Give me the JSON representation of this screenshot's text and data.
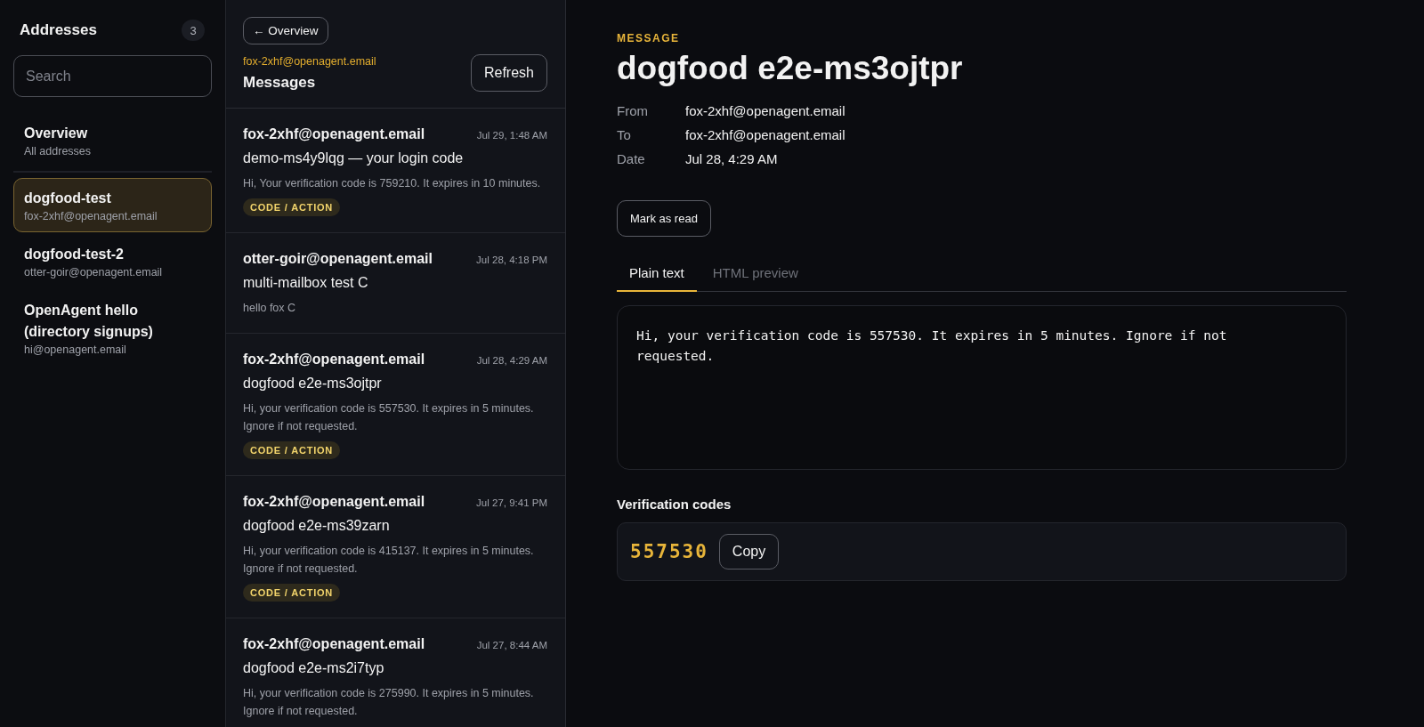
{
  "sidebar": {
    "title": "Addresses",
    "count": "3",
    "search": {
      "placeholder": "Search"
    },
    "overview": {
      "label": "Overview",
      "sublabel": "All addresses",
      "selected": false
    },
    "items": [
      {
        "name": "dogfood-test",
        "address": "fox-2xhf@openagent.email",
        "selected": true
      },
      {
        "name": "dogfood-test-2",
        "address": "otter-goir@openagent.email",
        "selected": false
      },
      {
        "name": "OpenAgent hello (directory signups)",
        "address": "hi@openagent.email",
        "selected": false
      }
    ]
  },
  "messages": {
    "back": "← Overview",
    "mailbox": "fox-2xhf@openagent.email",
    "title": "Messages",
    "refresh": "Refresh",
    "items": [
      {
        "from": "fox-2xhf@openagent.email",
        "time": "Jul 29, 1:48 AM",
        "subject": "demo-ms4y9lqg — your login code",
        "preview": "Hi, Your verification code is 759210. It expires in 10 minutes.",
        "tag": "CODE / ACTION"
      },
      {
        "from": "otter-goir@openagent.email",
        "time": "Jul 28, 4:18 PM",
        "subject": "multi-mailbox test C",
        "preview": "hello fox C"
      },
      {
        "from": "fox-2xhf@openagent.email",
        "time": "Jul 28, 4:29 AM",
        "subject": "dogfood e2e-ms3ojtpr",
        "preview": "Hi, your verification code is 557530. It expires in 5 minutes. Ignore if not requested.",
        "tag": "CODE / ACTION"
      },
      {
        "from": "fox-2xhf@openagent.email",
        "time": "Jul 27, 9:41 PM",
        "subject": "dogfood e2e-ms39zarn",
        "preview": "Hi, your verification code is 415137. It expires in 5 minutes. Ignore if not requested.",
        "tag": "CODE / ACTION"
      },
      {
        "from": "fox-2xhf@openagent.email",
        "time": "Jul 27, 8:44 AM",
        "subject": "dogfood e2e-ms2i7typ",
        "preview": "Hi, your verification code is 275990. It expires in 5 minutes. Ignore if not requested."
      }
    ]
  },
  "message": {
    "eyebrow": "MESSAGE",
    "subject": "dogfood e2e-ms3ojtpr",
    "meta": [
      {
        "label": "From",
        "value": "fox-2xhf@openagent.email"
      },
      {
        "label": "To",
        "value": "fox-2xhf@openagent.email"
      },
      {
        "label": "Date",
        "value": "Jul 28, 4:29 AM"
      }
    ],
    "mark_read": "Mark as read",
    "tabs": [
      {
        "label": "Plain text",
        "selected": true
      },
      {
        "label": "HTML preview",
        "selected": false
      }
    ],
    "body": "Hi, your verification code is 557530. It expires in 5 minutes. Ignore if not requested.",
    "codes_title": "Verification codes",
    "codes": [
      {
        "code": "557530",
        "copy": "Copy"
      }
    ]
  }
}
